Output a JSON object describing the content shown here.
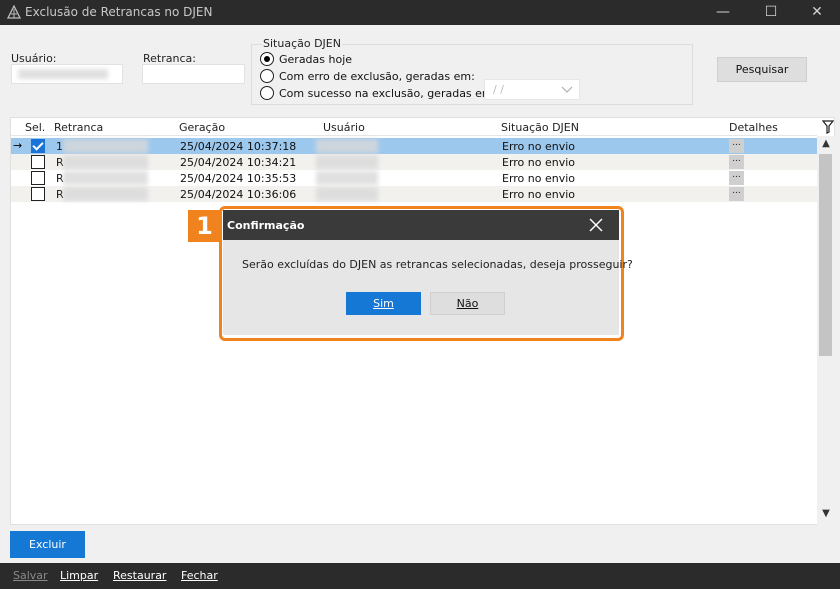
{
  "window": {
    "title": "Exclusão de Retrancas no DJEN",
    "minimize_glyph": "—",
    "maximize_glyph": "☐",
    "close_glyph": "✕"
  },
  "filters": {
    "usuario_label": "Usuário:",
    "retranca_label": "Retranca:",
    "situacao_legend": "Situação DJEN",
    "options": [
      {
        "label": "Geradas hoje",
        "checked": true
      },
      {
        "label": "Com erro de exclusão, geradas em:",
        "checked": false
      },
      {
        "label": "Com sucesso na exclusão, geradas em:",
        "checked": false
      }
    ],
    "date_value": "/ /",
    "search_button": "Pesquisar"
  },
  "table": {
    "headers": [
      "Sel.",
      "Retranca",
      "Geração",
      "Usuário",
      "Situação DJEN",
      "Detalhes"
    ],
    "rows": [
      {
        "selected": true,
        "current": true,
        "retranca": "1",
        "geracao": "25/04/2024 10:37:18",
        "situacao": "Erro no envio",
        "details": "..."
      },
      {
        "selected": false,
        "current": false,
        "retranca": "R",
        "geracao": "25/04/2024 10:34:21",
        "situacao": "Erro no envio",
        "details": "..."
      },
      {
        "selected": false,
        "current": false,
        "retranca": "R",
        "geracao": "25/04/2024 10:35:53",
        "situacao": "Erro no envio",
        "details": "..."
      },
      {
        "selected": false,
        "current": false,
        "retranca": "R",
        "geracao": "25/04/2024 10:36:06",
        "situacao": "Erro no envio",
        "details": "..."
      }
    ],
    "row_pointer": "→"
  },
  "actions": {
    "excluir": "Excluir"
  },
  "footer": {
    "items": [
      "Salvar",
      "Limpar",
      "Restaurar",
      "Fechar"
    ]
  },
  "dialog": {
    "step_number": "1",
    "title": "Confirmação",
    "message": "Serão excluídas do DJEN as retrancas selecionadas, deseja prosseguir?",
    "yes_label": "Sim",
    "no_label": "Não"
  },
  "colors": {
    "accent_blue": "#1478d4",
    "selected_row": "#9dc8ee",
    "highlight_orange": "#f0831e",
    "titlebar_dark": "#2b2b2b"
  }
}
